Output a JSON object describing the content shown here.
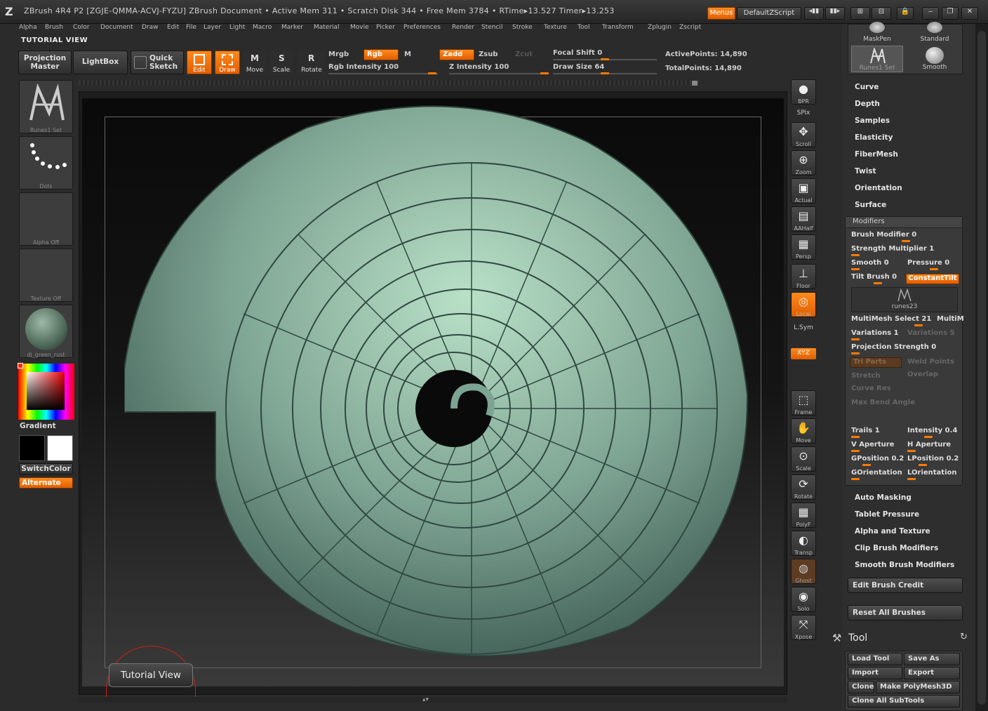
{
  "titlebar": {
    "title": "ZBrush 4R4 P2 [ZGJE-QMMA-ACVJ-FYZU]   ZBrush Document     • Active Mem 311 • Scratch Disk 344 • Free Mem 3784 • RTime▸13.527 Timer▸13.253",
    "menus_button": "Menus",
    "script_button": "DefaultZScript"
  },
  "menubar": [
    "Alpha",
    "Brush",
    "Color",
    "Document",
    "Draw",
    "Edit",
    "File",
    "Layer",
    "Light",
    "Macro",
    "Marker",
    "Material",
    "Movie",
    "Picker",
    "Preferences",
    "Render",
    "Stencil",
    "Stroke",
    "Texture",
    "Tool",
    "Transform",
    "Zplugin",
    "Zscript"
  ],
  "toolbar": {
    "title": "TUTORIAL VIEW",
    "projection_master": "Projection Master",
    "lightbox": "LightBox",
    "quick_sketch": "Quick Sketch",
    "edit": "Edit",
    "draw": "Draw",
    "move": "Move",
    "scale": "Scale",
    "rotate": "Rotate",
    "mrgb": "Mrgb",
    "rgb": "Rgb",
    "m": "M",
    "zadd": "Zadd",
    "zsub": "Zsub",
    "zcut": "Zcut",
    "rgb_intensity": "Rgb Intensity 100",
    "z_intensity": "Z Intensity 100",
    "focal_shift": "Focal Shift 0",
    "draw_size": "Draw Size 64",
    "active_points": "ActivePoints: 14,890",
    "total_points": "TotalPoints: 14,890"
  },
  "leftpanel": {
    "brush": "Runes1 Set",
    "stroke": "Dots",
    "alpha": "Alpha Off",
    "texture": "Texture Off",
    "material": "dj_green_rust",
    "gradient": "Gradient",
    "switchcolor": "SwitchColor",
    "alternate": "Alternate"
  },
  "canvas": {
    "tutorial_badge": "Tutorial View"
  },
  "dock": [
    "BPR",
    "SPix",
    "Scroll",
    "Zoom",
    "Actual",
    "AAHalf",
    "Persp",
    "Floor",
    "Local",
    "L.Sym",
    "XYZ",
    "Frame",
    "Move",
    "Scale",
    "Rotate",
    "PolyF",
    "Transp",
    "Ghost",
    "Solo",
    "Xpose"
  ],
  "rightpanel": {
    "brushes": [
      "MaskPen",
      "Standard",
      "Runes1 Set",
      "Smooth"
    ],
    "sections": [
      "Curve",
      "Depth",
      "Samples",
      "Elasticity",
      "FiberMesh",
      "Twist",
      "Orientation",
      "Surface"
    ],
    "modifiers_title": "Modifiers",
    "modifiers": {
      "brush_modifier": "Brush Modifier 0",
      "strength_multiplier": "Strength Multiplier 1",
      "smooth": "Smooth 0",
      "pressure": "Pressure 0",
      "tilt_brush": "Tilt Brush 0",
      "constant_tilt": "ConstantTilt",
      "runes": "runes23",
      "multimesh_select": "MultiMesh Select 21",
      "multim": "MultiM",
      "variations": "Variations 1",
      "variations_s": "Variations S",
      "projection_strength": "Projection Strength 0",
      "tri_parts": "Tri Parts",
      "weld_points": "Weld Points",
      "stretch": "Stretch",
      "overlap": "Overlap",
      "curve_res": "Curve Res",
      "max_bend_angle": "Max Bend Angle",
      "trails": "Trails 1",
      "intensity": "Intensity 0.4",
      "v_aperture": "V Aperture",
      "h_aperture": "H Aperture",
      "gposition": "GPosition 0.2",
      "lposition": "LPosition 0.2",
      "gorientation": "GOrientation",
      "lorientation": "LOrientation"
    },
    "sections2": [
      "Auto Masking",
      "Tablet Pressure",
      "Alpha and Texture",
      "Clip Brush Modifiers",
      "Smooth Brush Modifiers"
    ],
    "edit_brush_credit": "Edit Brush Credit",
    "reset_all_brushes": "Reset All Brushes",
    "tool_title": "Tool",
    "tool_buttons": {
      "load_tool": "Load Tool",
      "save_as": "Save As",
      "import": "Import",
      "export": "Export",
      "clone": "Clone",
      "make_polymesh": "Make PolyMesh3D",
      "clone_all": "Clone All SubTools"
    }
  }
}
